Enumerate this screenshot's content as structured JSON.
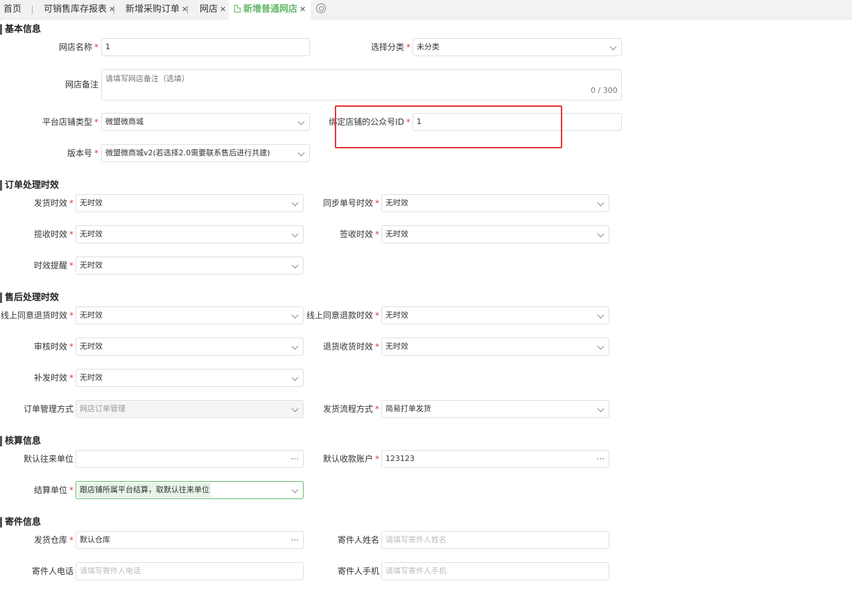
{
  "tabs": [
    {
      "label": "首页"
    },
    {
      "label": "可销售库存报表"
    },
    {
      "label": "新增采购订单"
    },
    {
      "label": "网店"
    },
    {
      "label": "新增普通网店"
    }
  ],
  "tab_close": "✕",
  "sections": {
    "basic": "基本信息",
    "order": "订单处理时效",
    "aftersale": "售后处理时效",
    "accounting": "核算信息",
    "sender": "寄件信息"
  },
  "required_mark": "*",
  "basic": {
    "store_name": {
      "label": "网店名称",
      "value": "1"
    },
    "category": {
      "label": "选择分类",
      "value": "未分类"
    },
    "remark": {
      "label": "网店备注",
      "placeholder": "请填写网店备注（选填）",
      "counter": "0 / 300"
    },
    "platform_type": {
      "label": "平台店铺类型",
      "value": "微盟微商城"
    },
    "official_account_id": {
      "label": "绑定店铺的公众号ID",
      "value": "1"
    },
    "version": {
      "label": "版本号",
      "value": "微盟微商城v2(若选择2.0需要联系售后进行共建)"
    }
  },
  "order": {
    "ship_time": {
      "label": "发货时效",
      "value": "无时效"
    },
    "sync_no_time": {
      "label": "同步单号时效",
      "value": "无时效"
    },
    "pickup_time": {
      "label": "揽收时效",
      "value": "无时效"
    },
    "sign_time": {
      "label": "签收时效",
      "value": "无时效"
    },
    "reminder": {
      "label": "时效提醒",
      "value": "无时效"
    }
  },
  "aftersale": {
    "online_return_goods": {
      "label": "线上同意退货时效",
      "value": "无时效"
    },
    "online_refund": {
      "label": "线上同意退款时效",
      "value": "无时效"
    },
    "review_time": {
      "label": "审核时效",
      "value": "无时效"
    },
    "return_receive_time": {
      "label": "退货收货时效",
      "value": "无时效"
    },
    "reissue_time": {
      "label": "补发时效",
      "value": "无时效"
    },
    "order_mgmt": {
      "label": "订单管理方式",
      "value": "网店订单管理"
    },
    "ship_process": {
      "label": "发货流程方式",
      "value": "简易打单发货"
    }
  },
  "accounting": {
    "default_partner": {
      "label": "默认往来单位",
      "value": ""
    },
    "default_account": {
      "label": "默认收款账户",
      "value": "123123"
    },
    "settle_unit": {
      "label": "结算单位",
      "value": "跟店铺所属平台结算，取默认往来单位"
    }
  },
  "sender": {
    "warehouse": {
      "label": "发货仓库",
      "value": "默认仓库"
    },
    "sender_name": {
      "label": "寄件人姓名",
      "placeholder": "请填写寄件人姓名"
    },
    "sender_phone": {
      "label": "寄件人电话",
      "placeholder": "请填写寄件人电话"
    },
    "sender_mobile": {
      "label": "寄件人手机",
      "placeholder": "请填写寄件人手机"
    }
  },
  "more_icon": "···",
  "colors": {
    "accent": "#67b96b",
    "required": "#e33333",
    "highlight_box": "#e53333"
  }
}
